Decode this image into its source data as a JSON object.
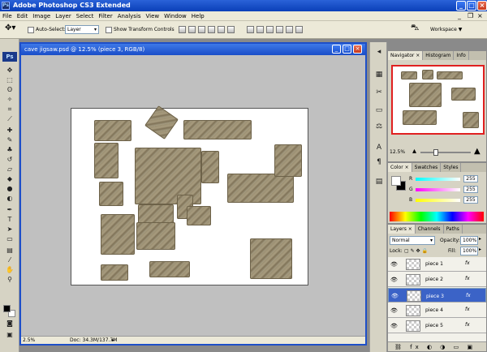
{
  "app": {
    "title": "Adobe Photoshop CS3 Extended",
    "logo": "Ps"
  },
  "menu": [
    "File",
    "Edit",
    "Image",
    "Layer",
    "Select",
    "Filter",
    "Analysis",
    "View",
    "Window",
    "Help"
  ],
  "options": {
    "auto_select_label": "Auto-Select:",
    "auto_select_value": "Layer",
    "show_transform_label": "Show Transform Controls",
    "workspace_label": "Workspace ▼"
  },
  "document": {
    "title": "cave jigsaw.psd @ 12.5% (piece 3, RGB/8)",
    "status_zoom": "2.5%",
    "status_doc": "Doc: 34.3M/137.7M"
  },
  "navigator": {
    "tabs": [
      "Navigator ×",
      "Histogram",
      "Info"
    ],
    "zoom": "12.5%"
  },
  "color": {
    "tabs": [
      "Color ×",
      "Swatches",
      "Styles"
    ],
    "channels": [
      {
        "label": "R",
        "value": "255"
      },
      {
        "label": "G",
        "value": "255"
      },
      {
        "label": "B",
        "value": "255"
      }
    ]
  },
  "layers": {
    "tabs": [
      "Layers ×",
      "Channels",
      "Paths"
    ],
    "blend_mode": "Normal",
    "opacity_label": "Opacity:",
    "opacity_value": "100%",
    "lock_label": "Lock:",
    "fill_label": "Fill:",
    "fill_value": "100%",
    "items": [
      {
        "name": "piece 1",
        "selected": false
      },
      {
        "name": "piece 2",
        "selected": false
      },
      {
        "name": "piece 3",
        "selected": true
      },
      {
        "name": "piece 4",
        "selected": false
      },
      {
        "name": "piece 5",
        "selected": false
      }
    ],
    "fx_label": "fx"
  },
  "colors": {
    "titlebar": "#0a3fb8",
    "chrome": "#ece9d8",
    "selection": "#3b63c7"
  }
}
